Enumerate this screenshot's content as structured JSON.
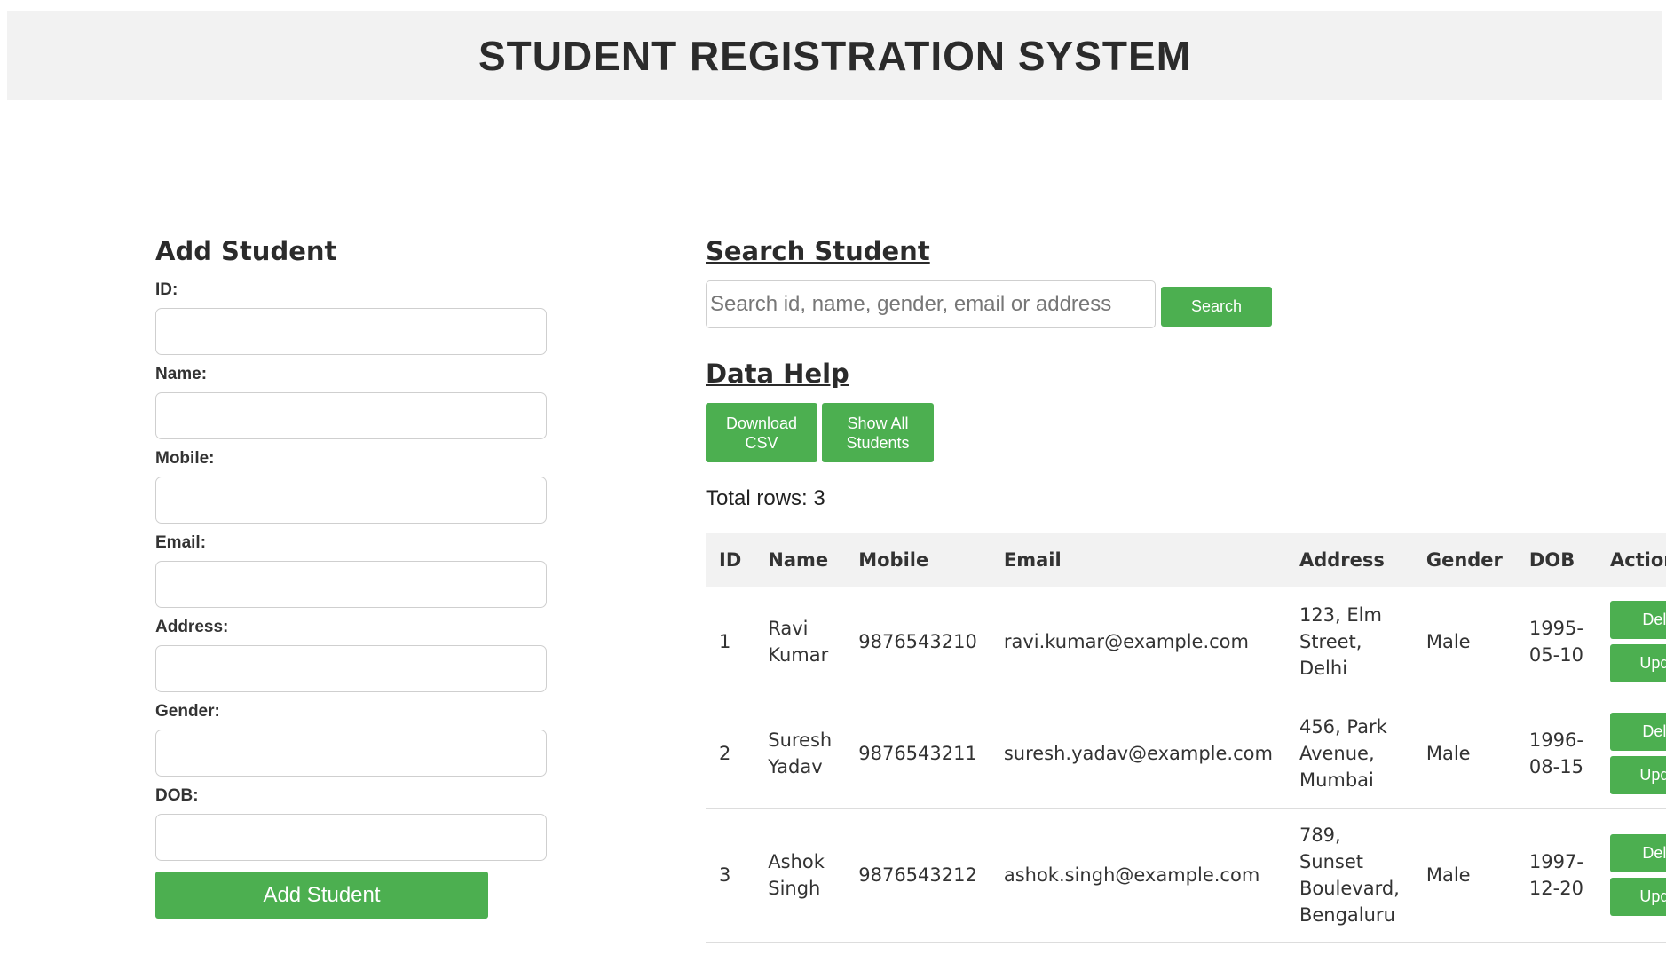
{
  "header": {
    "title": "STUDENT REGISTRATION SYSTEM"
  },
  "add_form": {
    "title": "Add Student",
    "fields": [
      {
        "label": "ID:",
        "value": ""
      },
      {
        "label": "Name:",
        "value": ""
      },
      {
        "label": "Mobile:",
        "value": ""
      },
      {
        "label": "Email:",
        "value": ""
      },
      {
        "label": "Address:",
        "value": ""
      },
      {
        "label": "Gender:",
        "value": ""
      },
      {
        "label": "DOB:",
        "value": ""
      }
    ],
    "submit_label": "Add Student"
  },
  "search": {
    "title": "Search Student",
    "placeholder": "Search id, name, gender, email or address",
    "button_label": "Search"
  },
  "data_help": {
    "title": "Data Help",
    "download_label": "Download CSV",
    "show_all_label": "Show All Students",
    "total_rows": "Total rows: 3"
  },
  "table": {
    "columns": [
      "ID",
      "Name",
      "Mobile",
      "Email",
      "Address",
      "Gender",
      "DOB",
      "Action"
    ],
    "rows": [
      {
        "id": "1",
        "name": "Ravi Kumar",
        "mobile": "9876543210",
        "email": "ravi.kumar@example.com",
        "address": "123, Elm Street, Delhi",
        "gender": "Male",
        "dob": "1995-05-10"
      },
      {
        "id": "2",
        "name": "Suresh Yadav",
        "mobile": "9876543211",
        "email": "suresh.yadav@example.com",
        "address": "456, Park Avenue, Mumbai",
        "gender": "Male",
        "dob": "1996-08-15"
      },
      {
        "id": "3",
        "name": "Ashok Singh",
        "mobile": "9876543212",
        "email": "ashok.singh@example.com",
        "address": "789, Sunset Boulevard, Bengaluru",
        "gender": "Male",
        "dob": "1997-12-20"
      }
    ],
    "delete_label": "Delete",
    "update_label": "Update"
  },
  "colors": {
    "accent": "#4caf50",
    "header_bg": "#f2f2f2"
  }
}
